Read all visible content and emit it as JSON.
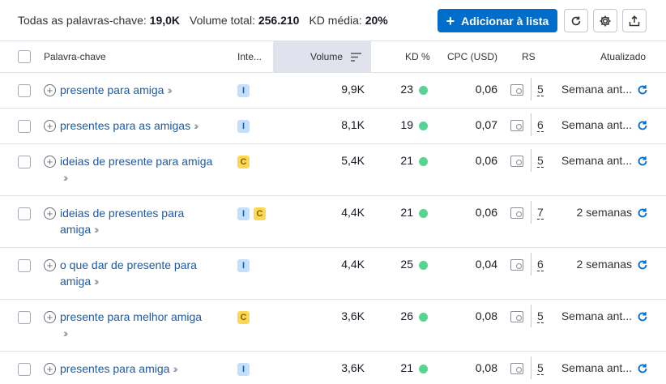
{
  "stats": {
    "keywords_label": "Todas as palavras-chave:",
    "keywords_value": "19,0K",
    "volume_label": "Volume total:",
    "volume_value": "256.210",
    "kd_label": "KD média:",
    "kd_value": "20%"
  },
  "toolbar": {
    "add_label": "Adicionar à lista",
    "accent_color": "#006dca"
  },
  "columns": {
    "keyword": "Palavra-chave",
    "intent": "Inte...",
    "volume": "Volume",
    "kd": "KD %",
    "cpc": "CPC (USD)",
    "rs": "RS",
    "updated": "Atualizado"
  },
  "rows": [
    {
      "kw1": "presente para amiga",
      "kw2": "",
      "intents": [
        "I"
      ],
      "volume": "9,9K",
      "kd": "23",
      "cpc": "0,06",
      "rs": "5",
      "updated": "Semana ant..."
    },
    {
      "kw1": "presentes para as amigas",
      "kw2": "",
      "intents": [
        "I"
      ],
      "volume": "8,1K",
      "kd": "19",
      "cpc": "0,07",
      "rs": "6",
      "updated": "Semana ant..."
    },
    {
      "kw1": "ideias de presente para amiga",
      "kw2": "",
      "intents": [
        "C"
      ],
      "volume": "5,4K",
      "kd": "21",
      "cpc": "0,06",
      "rs": "5",
      "updated": "Semana ant..."
    },
    {
      "kw1": "ideias de presentes para",
      "kw2": "amiga",
      "intents": [
        "I",
        "C"
      ],
      "volume": "4,4K",
      "kd": "21",
      "cpc": "0,06",
      "rs": "7",
      "updated": "2 semanas"
    },
    {
      "kw1": "o que dar de presente para",
      "kw2": "amiga",
      "intents": [
        "I"
      ],
      "volume": "4,4K",
      "kd": "25",
      "cpc": "0,04",
      "rs": "6",
      "updated": "2 semanas"
    },
    {
      "kw1": "presente para melhor amiga",
      "kw2": "",
      "intents": [
        "C"
      ],
      "volume": "3,6K",
      "kd": "26",
      "cpc": "0,08",
      "rs": "5",
      "updated": "Semana ant..."
    },
    {
      "kw1": "presentes para amiga",
      "kw2": "",
      "intents": [
        "I"
      ],
      "volume": "3,6K",
      "kd": "21",
      "cpc": "0,08",
      "rs": "5",
      "updated": "Semana ant..."
    }
  ],
  "icons": {
    "kd_dot_color": "#59d294",
    "refresh": "refresh-icon",
    "settings": "gear-icon",
    "export": "export-icon",
    "sort": "sort-icon",
    "serp": "serp-icon"
  }
}
